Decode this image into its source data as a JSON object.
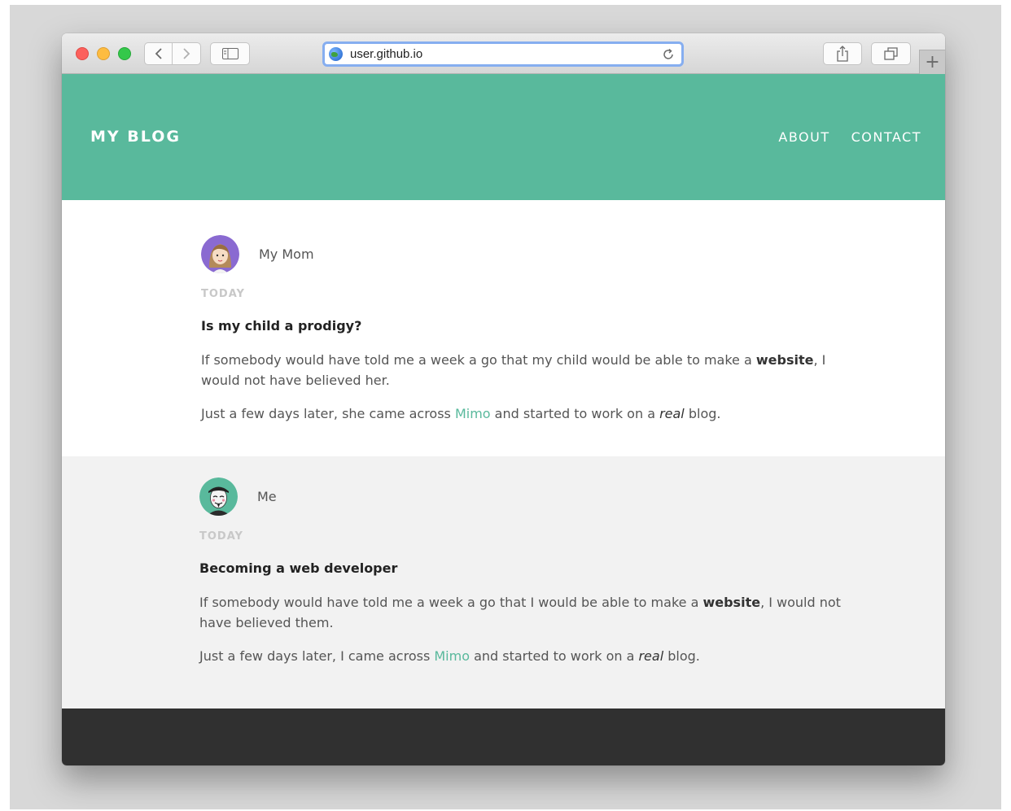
{
  "browser": {
    "url": "user.github.io",
    "new_tab_symbol": "+"
  },
  "site": {
    "brand": "MY BLOG",
    "nav": [
      "ABOUT",
      "CONTACT"
    ]
  },
  "posts": [
    {
      "author": "My Mom",
      "date": "TODAY",
      "title": "Is my child a prodigy?",
      "p1_before": "If somebody would have told me a week a go that my child would be able to make a ",
      "p1_bold": "website",
      "p1_after": ", I would not have believed her.",
      "p2_before": "Just a few days later, she came across ",
      "p2_link": "Mimo",
      "p2_middle": " and started to work on a ",
      "p2_italic": "real",
      "p2_after": " blog."
    },
    {
      "author": "Me",
      "date": "TODAY",
      "title": "Becoming a web developer",
      "p1_before": "If somebody would have told me a week a go that I would be able to make a ",
      "p1_bold": "website",
      "p1_after": ", I would not have believed them.",
      "p2_before": "Just a few days later, I came across ",
      "p2_link": "Mimo",
      "p2_middle": " and started to work on a ",
      "p2_italic": "real",
      "p2_after": " blog."
    }
  ],
  "colors": {
    "header": "#59b99c",
    "accent": "#59b99c",
    "footer": "#303030",
    "alt_section": "#f2f2f2"
  },
  "icons": [
    "back-icon",
    "forward-icon",
    "sidebar-icon",
    "globe-icon",
    "reload-icon",
    "share-icon",
    "tabs-icon",
    "plus-icon"
  ]
}
